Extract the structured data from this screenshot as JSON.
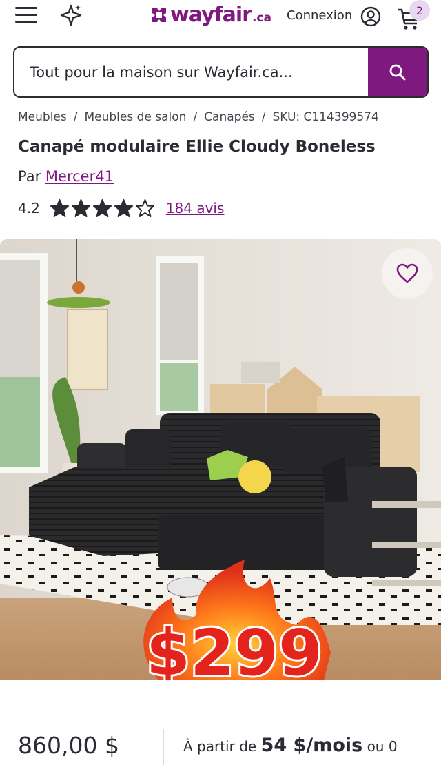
{
  "header": {
    "logo_text": "wayfair",
    "logo_suffix": ".ca",
    "signin_label": "Connexion",
    "cart_count": "2"
  },
  "search": {
    "placeholder": "Tout pour la maison sur Wayfair.ca..."
  },
  "breadcrumb": [
    "Meubles",
    "Meubles de salon",
    "Canapés",
    "SKU: C114399574"
  ],
  "product": {
    "title": "Canapé modulaire Ellie Cloudy Boneless",
    "by_prefix": "Par",
    "brand": "Mercer41",
    "rating": "4.2",
    "rating_value": 4.2,
    "reviews_label": "184 avis"
  },
  "image_overlay": {
    "promo_price": "$299"
  },
  "pricing": {
    "price": "860,00 $",
    "financing_prefix": "À partir de",
    "financing_amount": "54 $/mois",
    "financing_suffix": "ou 0"
  },
  "colors": {
    "brand": "#7f187f",
    "text": "#2b2b33"
  }
}
